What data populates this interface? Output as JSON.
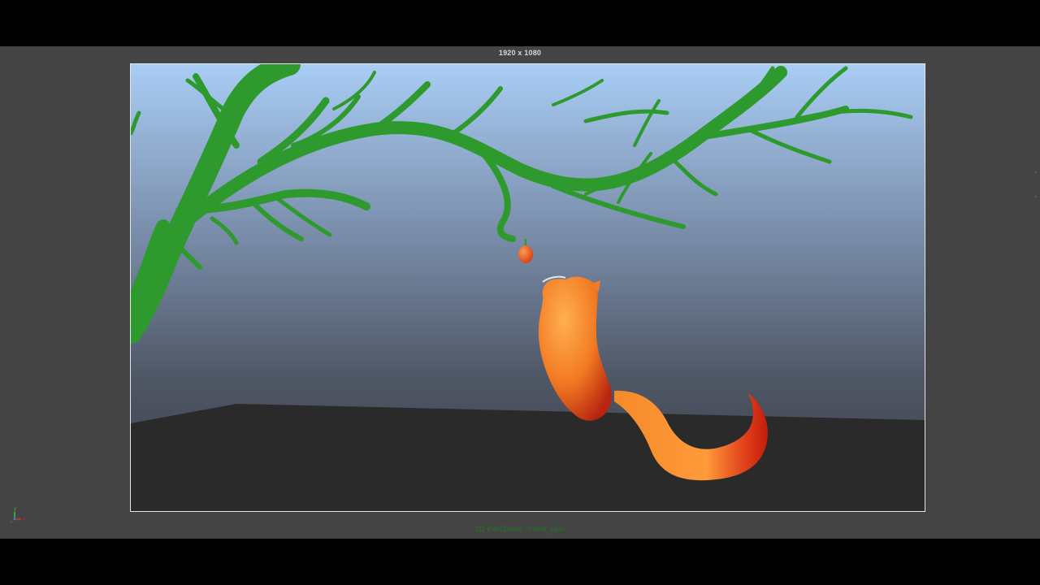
{
  "viewport": {
    "resolution_label": "1920 x 1080",
    "camera_label": "2D Pan/Zoom : Front_cam"
  },
  "scene": {
    "objects": [
      "sky",
      "tree-branches",
      "apple",
      "ground",
      "fox-body",
      "fox-tail"
    ],
    "colors": {
      "sky_top": "#a9cdf5",
      "sky_bottom": "#3c3d45",
      "tree": "#2e9a2e",
      "ground": "#2a2a2a",
      "fox_light": "#ffa040",
      "fox_dark": "#c42810"
    }
  },
  "axis_gizmo": {
    "icon": "axis-gizmo-icon",
    "labels": [
      "y",
      "z",
      "x"
    ]
  }
}
